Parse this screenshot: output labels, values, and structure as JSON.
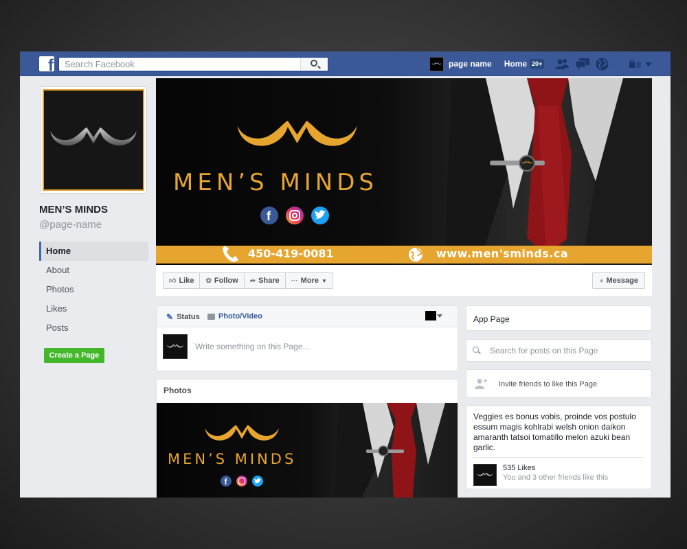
{
  "topbar": {
    "search_placeholder": "Search Facebook",
    "page_name": "page name",
    "home_label": "Home",
    "home_badge": "20+"
  },
  "profile": {
    "title": "MEN’S MINDS",
    "handle": "@page-name"
  },
  "left_nav": {
    "items": [
      {
        "label": "Home",
        "active": true
      },
      {
        "label": "About"
      },
      {
        "label": "Photos"
      },
      {
        "label": "Likes"
      },
      {
        "label": "Posts"
      }
    ],
    "create_page": "Create a Page"
  },
  "cover": {
    "brand": "MEN’S MINDS",
    "phone": "450-419-0081",
    "website": "www.men'sminds.ca",
    "brand_color": "#e6a52e"
  },
  "actions": {
    "like": "Like",
    "follow": "Follow",
    "share": "Share",
    "more": "More",
    "message": "Message"
  },
  "composer": {
    "status_tab": "Status",
    "photo_tab": "Photo/Video",
    "placeholder": "Write something on this Page..."
  },
  "photos": {
    "title": "Photos",
    "brand": "MEN’S MINDS"
  },
  "sidebar": {
    "app_page": "App Page",
    "search_posts": "Search for posts on this Page",
    "invite": "Invite friends to like this Page",
    "about_text": "Veggies es bonus vobis, proinde vos postulo essum magis kohlrabi welsh onion daikon amaranth tatsoi tomatillo melon azuki bean garlic.",
    "likes_count": "535 Likes",
    "likes_friends": "You and 3 other friends like this"
  },
  "colors": {
    "fb_blue": "#3b5998",
    "accent_gold": "#e6a52e",
    "create_green": "#42b72a"
  }
}
